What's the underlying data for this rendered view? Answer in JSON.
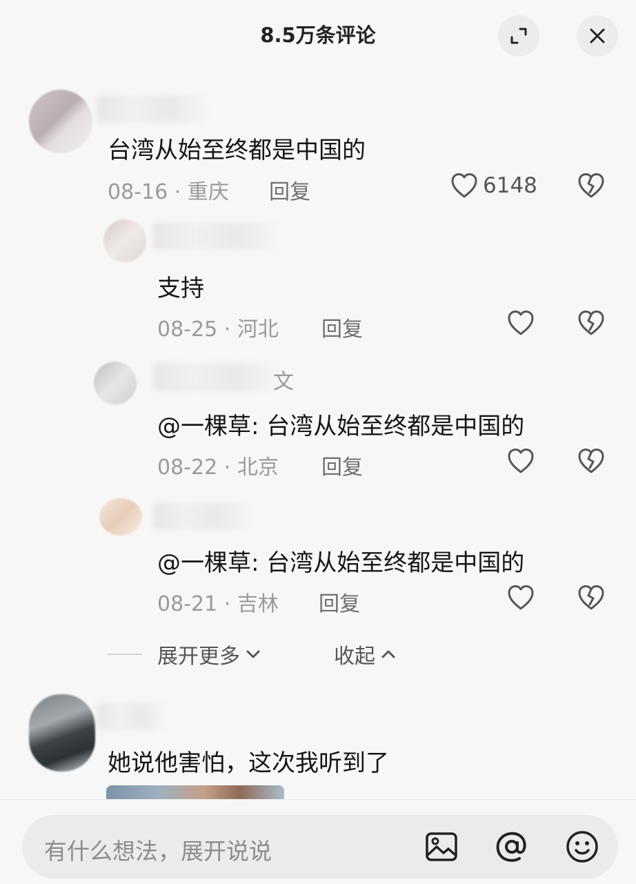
{
  "header": {
    "title": "8.5万条评论",
    "expand_icon": "expand-icon",
    "close_icon": "close-icon"
  },
  "comments": [
    {
      "text": "台湾从始至终都是中国的",
      "date": "08-16",
      "location": "重庆",
      "reply": "回复",
      "likes": "6148"
    },
    {
      "text": "支持",
      "date": "08-25",
      "location": "河北",
      "reply": "回复"
    },
    {
      "name_fragment": "文",
      "text": "@一棵草: 台湾从始至终都是中国的",
      "date": "08-22",
      "location": "北京",
      "reply": "回复"
    },
    {
      "text": "@一棵草: 台湾从始至终都是中国的",
      "date": "08-21",
      "location": "吉林",
      "reply": "回复"
    },
    {
      "text": "她说他害怕，这次我听到了"
    }
  ],
  "thread": {
    "expand_more": "展开更多",
    "collapse": "收起"
  },
  "input": {
    "placeholder": "有什么想法，展开说说"
  },
  "separator": "·"
}
